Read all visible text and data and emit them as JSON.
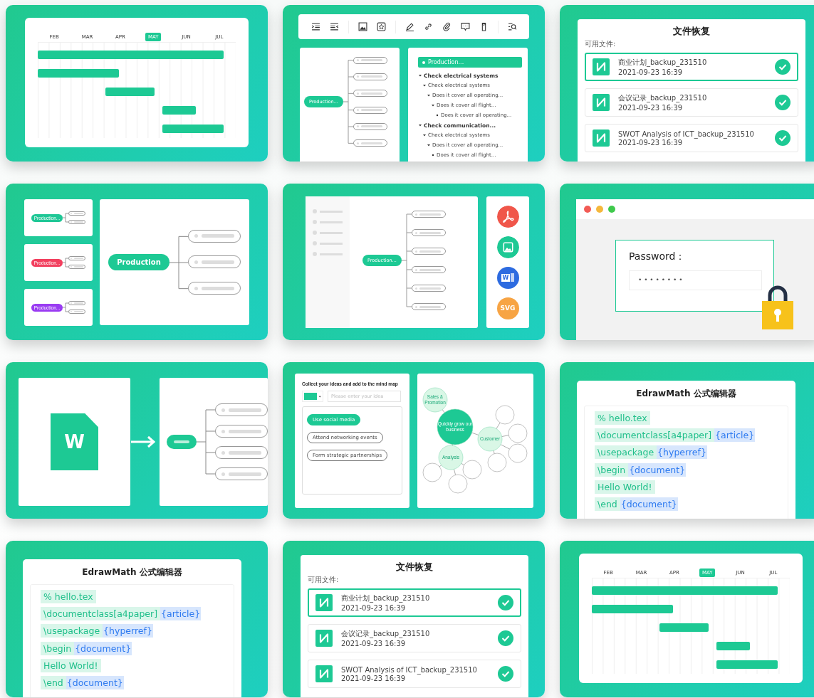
{
  "tiles": [
    {
      "kind": "gantt",
      "months": [
        {
          "label": "FEB",
          "selected": false
        },
        {
          "label": "MAR",
          "selected": false
        },
        {
          "label": "APR",
          "selected": false
        },
        {
          "label": "MAY",
          "selected": true
        },
        {
          "label": "JUN",
          "selected": false
        },
        {
          "label": "JUL",
          "selected": false
        }
      ]
    },
    {
      "kind": "outline",
      "root": "Production...",
      "header": "Production...",
      "items": [
        {
          "text": "Check electrical systems",
          "children": [
            {
              "text": "Check electrical systems",
              "children": [
                {
                  "text": "Does it cover all operating...",
                  "children": [
                    {
                      "text": "Does it cover all flight...",
                      "children": [
                        {
                          "text": "Does it cover all operating..."
                        }
                      ]
                    }
                  ]
                }
              ]
            }
          ]
        },
        {
          "text": "Check communication...",
          "children": [
            {
              "text": "Check electrical systems",
              "children": [
                {
                  "text": "Does it cover all operating...",
                  "children": [
                    {
                      "text": "Does it cover all flight..."
                    }
                  ]
                }
              ]
            }
          ]
        }
      ]
    },
    {
      "kind": "recovery",
      "title": "文件恢复",
      "label": "可用文件:",
      "files": [
        {
          "name": "商业计划_backup_231510",
          "time": "2021-09-23 16:39",
          "selected": true
        },
        {
          "name": "会议记录_backup_231510",
          "time": "2021-09-23 16:39",
          "selected": false
        },
        {
          "name": "SWOT Analysis of ICT_backup_231510",
          "time": "2021-09-23 16:39",
          "selected": false
        }
      ]
    },
    {
      "kind": "themes",
      "root": "Production",
      "variants": [
        {
          "label": "Production...",
          "color": "#1fc796"
        },
        {
          "label": "Production...",
          "color": "#f2405f"
        },
        {
          "label": "Production...",
          "color": "#9a3cf2"
        }
      ]
    },
    {
      "kind": "export",
      "root": "Production...",
      "formats": [
        {
          "kind": "pdf"
        },
        {
          "kind": "image"
        },
        {
          "kind": "word",
          "label": "W"
        },
        {
          "kind": "svg",
          "label": "SVG"
        }
      ]
    },
    {
      "kind": "password",
      "label": "Password：",
      "value": "• • • • • • • •"
    },
    {
      "kind": "import",
      "doc_label": "W"
    },
    {
      "kind": "ideas",
      "heading": "Collect your ideas and add to the mind map",
      "placeholder": "Please enter your idea",
      "ideas": [
        {
          "text": "Use social media",
          "selected": true
        },
        {
          "text": "Attend networking events",
          "selected": false
        },
        {
          "text": "Form strategic partnerships",
          "selected": false
        }
      ],
      "bubbles": [
        {
          "text": "Sales & Promotion",
          "kind": "topic"
        },
        {
          "text": "Quickly grow our business",
          "kind": "center"
        },
        {
          "text": "Customer",
          "kind": "topic"
        },
        {
          "text": "Analysis",
          "kind": "topic"
        }
      ]
    },
    {
      "kind": "math",
      "title": "EdrawMath 公式编辑器",
      "lines": [
        {
          "code": "% hello.tex"
        },
        {
          "code": "\\documentclass[a4paper]",
          "arg": "{article}"
        },
        {
          "code": "\\usepackage",
          "arg": "{hyperref}"
        },
        {
          "code": "\\begin",
          "arg": "{document}"
        },
        {
          "code": "Hello World!"
        },
        {
          "code": "\\end",
          "arg": "{document}"
        }
      ]
    },
    {
      "kind": "math",
      "title": "EdrawMath 公式编辑器",
      "lines": [
        {
          "code": "% hello.tex"
        },
        {
          "code": "\\documentclass[a4paper]",
          "arg": "{article}"
        },
        {
          "code": "\\usepackage",
          "arg": "{hyperref}"
        },
        {
          "code": "\\begin",
          "arg": "{document}"
        },
        {
          "code": "Hello World!"
        },
        {
          "code": "\\end",
          "arg": "{document}"
        }
      ]
    },
    {
      "kind": "recovery",
      "title": "文件恢复",
      "label": "可用文件:",
      "files": [
        {
          "name": "商业计划_backup_231510",
          "time": "2021-09-23 16:39",
          "selected": true
        },
        {
          "name": "会议记录_backup_231510",
          "time": "2021-09-23 16:39",
          "selected": false
        },
        {
          "name": "SWOT Analysis of ICT_backup_231510",
          "time": "2021-09-23 16:39",
          "selected": false
        }
      ]
    },
    {
      "kind": "gantt",
      "months": [
        {
          "label": "FEB",
          "selected": false
        },
        {
          "label": "MAR",
          "selected": false
        },
        {
          "label": "APR",
          "selected": false
        },
        {
          "label": "MAY",
          "selected": true
        },
        {
          "label": "JUN",
          "selected": false
        },
        {
          "label": "JUL",
          "selected": false
        }
      ]
    }
  ]
}
